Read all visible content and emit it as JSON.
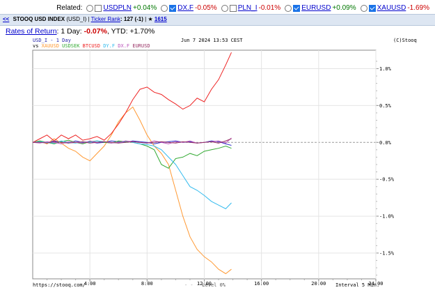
{
  "related": {
    "label": "Related:",
    "items": [
      {
        "name": "USDPLN",
        "change": "+0.04%",
        "checked": false
      },
      {
        "name": "DX.F",
        "change": "-0.05%",
        "checked": true
      },
      {
        "name": "PLN_I",
        "change": "-0.01%",
        "checked": false
      },
      {
        "name": "EURUSD",
        "change": "+0.09%",
        "checked": true
      },
      {
        "name": "XAUUSD",
        "change": "-1.69%",
        "checked": true
      }
    ]
  },
  "header": {
    "back": "<<",
    "title": "STOOQ USD INDEX",
    "symbol": "(USD_I)",
    "separator1": "|",
    "ticker_rank_label": "Ticker Rank",
    "ticker_rank_value": ": 127 (-1)",
    "separator2": "|",
    "star": "★",
    "rank_link": "1615"
  },
  "returns": {
    "label": "Rates of Return",
    "day_text": ": 1 Day: ",
    "day_value": "-0.07%",
    "ytd_text": ", YTD: ",
    "ytd_value": "+1.70%"
  },
  "chart_meta": {
    "name_line": "USD_I - 1 Day",
    "datetime": "Jun 7 2024 13:53 CEST",
    "copyright": "(C)Stooq",
    "vs_label": "vs",
    "footer_url": "https://stooq.com/",
    "level_label": "Level 0%",
    "interval_label": "Interval 5 Min."
  },
  "chart_data": {
    "type": "line",
    "xlabel": "",
    "ylabel": "",
    "xlim": [
      0,
      24
    ],
    "ylim": [
      -1.85,
      1.25
    ],
    "x_ticks": [
      "4:00",
      "8:00",
      "12:00",
      "16:00",
      "20:00",
      "24:00"
    ],
    "y_ticks": [
      "1.0%",
      "0.5%",
      "0.0%",
      "-0.5%",
      "-1.0%",
      "-1.5%"
    ],
    "grid": true,
    "series": [
      {
        "name": "USD_I",
        "color": "#3333cc",
        "x": [
          0,
          0.5,
          1,
          1.5,
          2,
          2.5,
          3,
          3.5,
          4,
          4.5,
          5,
          5.5,
          6,
          6.5,
          7,
          7.5,
          8,
          8.5,
          9,
          9.5,
          10,
          10.5,
          11,
          11.5,
          12,
          12.5,
          13,
          13.5,
          13.9
        ],
        "values": [
          0.0,
          0.01,
          0.0,
          0.02,
          0.0,
          -0.01,
          0.02,
          0.0,
          0.01,
          -0.01,
          0.0,
          0.02,
          0.01,
          0.0,
          0.02,
          0.01,
          0.0,
          -0.02,
          0.0,
          0.01,
          0.02,
          0.0,
          0.01,
          -0.01,
          0.0,
          0.02,
          0.01,
          -0.02,
          -0.04
        ]
      },
      {
        "name": "XAUUSD",
        "color": "#ff9933",
        "x": [
          0,
          0.5,
          1,
          1.5,
          2,
          2.5,
          3,
          3.5,
          4,
          4.5,
          5,
          5.5,
          6,
          6.5,
          7,
          7.5,
          8,
          8.5,
          9,
          9.5,
          10,
          10.5,
          11,
          11.5,
          12,
          12.5,
          13,
          13.5,
          13.9
        ],
        "values": [
          0.0,
          0.02,
          -0.02,
          0.05,
          -0.01,
          -0.08,
          -0.12,
          -0.2,
          -0.25,
          -0.15,
          -0.05,
          0.1,
          0.28,
          0.4,
          0.48,
          0.3,
          0.1,
          -0.05,
          -0.15,
          -0.3,
          -0.65,
          -1.0,
          -1.28,
          -1.45,
          -1.55,
          -1.62,
          -1.72,
          -1.78,
          -1.72
        ]
      },
      {
        "name": "USDSEK",
        "color": "#33aa33",
        "x": [
          0,
          0.5,
          1,
          1.5,
          2,
          2.5,
          3,
          3.5,
          4,
          4.5,
          5,
          5.5,
          6,
          6.5,
          7,
          7.5,
          8,
          8.5,
          9,
          9.5,
          10,
          10.5,
          11,
          11.5,
          12,
          12.5,
          13,
          13.5,
          13.9
        ],
        "values": [
          0.0,
          0.02,
          0.0,
          -0.02,
          0.01,
          0.03,
          0.0,
          -0.02,
          0.01,
          0.02,
          0.0,
          -0.01,
          0.02,
          0.01,
          0.0,
          -0.02,
          -0.05,
          -0.1,
          -0.3,
          -0.35,
          -0.22,
          -0.2,
          -0.15,
          -0.18,
          -0.12,
          -0.1,
          -0.08,
          -0.05,
          -0.08
        ]
      },
      {
        "name": "BTCUSD",
        "color": "#ee2222",
        "x": [
          0,
          0.5,
          1,
          1.5,
          2,
          2.5,
          3,
          3.5,
          4,
          4.5,
          5,
          5.5,
          6,
          6.5,
          7,
          7.5,
          8,
          8.5,
          9,
          9.5,
          10,
          10.5,
          11,
          11.5,
          12,
          12.5,
          13,
          13.5,
          13.9
        ],
        "values": [
          0.0,
          0.05,
          0.1,
          0.02,
          0.1,
          0.05,
          0.1,
          0.03,
          0.05,
          0.08,
          0.03,
          0.12,
          0.25,
          0.4,
          0.58,
          0.72,
          0.75,
          0.68,
          0.65,
          0.58,
          0.52,
          0.45,
          0.5,
          0.6,
          0.55,
          0.72,
          0.85,
          1.05,
          1.22
        ]
      },
      {
        "name": "DY.F",
        "color": "#33bbee",
        "x": [
          0,
          0.5,
          1,
          1.5,
          2,
          2.5,
          3,
          3.5,
          4,
          4.5,
          5,
          5.5,
          6,
          6.5,
          7,
          7.5,
          8,
          8.5,
          9,
          9.5,
          10,
          10.5,
          11,
          11.5,
          12,
          12.5,
          13,
          13.5,
          13.9
        ],
        "values": [
          0.0,
          0.01,
          0.0,
          -0.01,
          0.02,
          0.0,
          -0.01,
          0.01,
          0.0,
          0.02,
          0.01,
          0.0,
          -0.01,
          0.02,
          0.0,
          -0.02,
          -0.03,
          -0.05,
          -0.1,
          -0.2,
          -0.3,
          -0.45,
          -0.6,
          -0.65,
          -0.72,
          -0.8,
          -0.85,
          -0.9,
          -0.82
        ]
      },
      {
        "name": "DX.F",
        "color": "#bb55bb",
        "x": [
          0,
          0.5,
          1,
          1.5,
          2,
          2.5,
          3,
          3.5,
          4,
          4.5,
          5,
          5.5,
          6,
          6.5,
          7,
          7.5,
          8,
          8.5,
          9,
          9.5,
          10,
          10.5,
          11,
          11.5,
          12,
          12.5,
          13,
          13.5,
          13.9
        ],
        "values": [
          0.0,
          -0.01,
          0.01,
          0.0,
          -0.02,
          0.01,
          0.0,
          -0.01,
          0.02,
          0.0,
          0.01,
          -0.01,
          0.0,
          0.02,
          0.01,
          0.0,
          -0.01,
          0.02,
          0.0,
          -0.02,
          0.01,
          0.0,
          0.02,
          -0.01,
          0.0,
          0.01,
          0.02,
          -0.01,
          0.06
        ]
      },
      {
        "name": "EURUSD",
        "color": "#993366",
        "x": [
          0,
          0.5,
          1,
          1.5,
          2,
          2.5,
          3,
          3.5,
          4,
          4.5,
          5,
          5.5,
          6,
          6.5,
          7,
          7.5,
          8,
          8.5,
          9,
          9.5,
          10,
          10.5,
          11,
          11.5,
          12,
          12.5,
          13,
          13.5,
          13.9
        ],
        "values": [
          0.0,
          0.0,
          -0.01,
          0.01,
          0.0,
          -0.01,
          0.0,
          0.01,
          -0.01,
          0.0,
          0.01,
          0.0,
          -0.01,
          0.0,
          0.01,
          0.0,
          -0.01,
          0.0,
          0.01,
          0.0,
          -0.01,
          0.01,
          0.0,
          -0.01,
          0.0,
          0.01,
          -0.01,
          0.02,
          0.05
        ]
      }
    ]
  }
}
